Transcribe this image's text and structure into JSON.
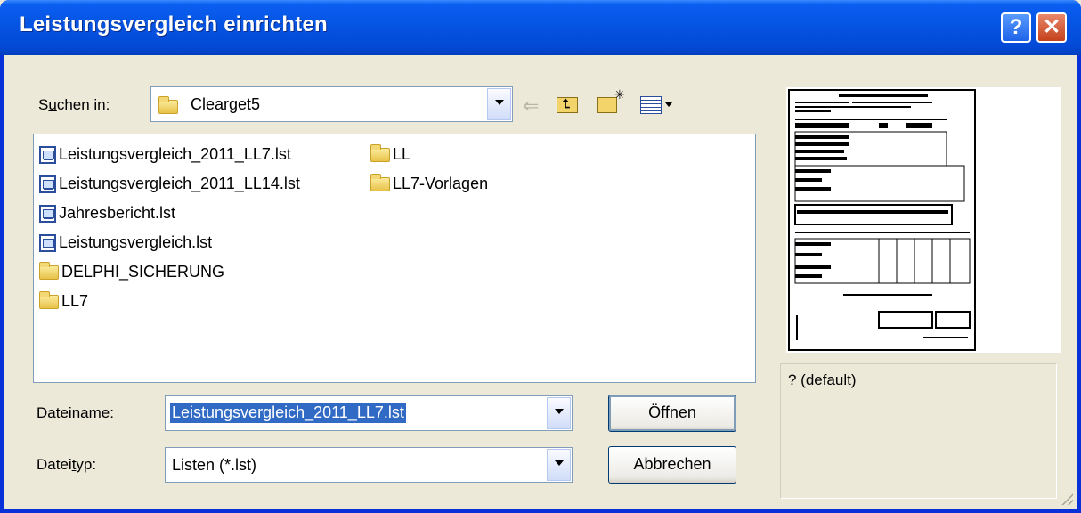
{
  "window": {
    "title": "Leistungsvergleich einrichten"
  },
  "titlebar": {
    "help_label": "?",
    "close_label": "✕"
  },
  "lookin": {
    "label_prefix": "S",
    "label_underline": "u",
    "label_rest": "chen in:",
    "value": "Clearget5"
  },
  "toolbar_icons": [
    "back-arrow-icon",
    "up-folder-icon",
    "new-folder-icon",
    "view-menu-icon"
  ],
  "files": {
    "col1": [
      {
        "name": "Leistungsvergleich_2011_LL7.lst",
        "type": "lst"
      },
      {
        "name": "Leistungsvergleich_2011_LL14.lst",
        "type": "lst"
      },
      {
        "name": "Jahresbericht.lst",
        "type": "lst"
      },
      {
        "name": "Leistungsvergleich.lst",
        "type": "lst"
      },
      {
        "name": "DELPHI_SICHERUNG",
        "type": "folder"
      },
      {
        "name": "LL7",
        "type": "folder"
      }
    ],
    "col2": [
      {
        "name": "LL",
        "type": "folder"
      },
      {
        "name": "LL7-Vorlagen",
        "type": "folder"
      }
    ]
  },
  "filename": {
    "label_prefix": "Datei",
    "label_underline": "n",
    "label_rest": "ame:",
    "value": "Leistungsvergleich_2011_LL7.lst"
  },
  "filetype": {
    "label_prefix": "Datei",
    "label_underline": "t",
    "label_rest": "yp:",
    "value": "Listen (*.lst)"
  },
  "buttons": {
    "open_underline": "Ö",
    "open_rest": "ffnen",
    "cancel": "Abbrechen"
  },
  "info": {
    "text": "? (default)"
  },
  "colors": {
    "titlebar": "#0654E3",
    "selection": "#316AC5",
    "face": "#ECE9D8"
  }
}
